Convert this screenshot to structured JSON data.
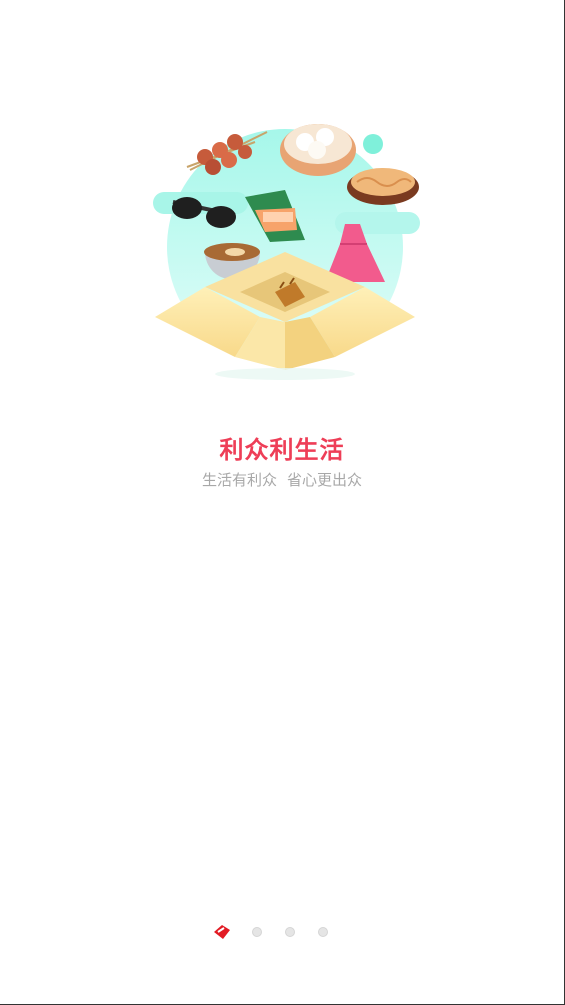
{
  "onboarding": {
    "title": "利众利生活",
    "subtitle_left": "生活有利众",
    "subtitle_right": "省心更出众"
  },
  "illustration": {
    "description_icon": "gift-box-illustration-icon",
    "accent_color": "#ee3e57",
    "background_gradient": [
      "#8ff2e0",
      "#d6fbf5"
    ]
  },
  "pager": {
    "active_color": "#e21b24",
    "inactive_color": "#e5e5e5"
  }
}
